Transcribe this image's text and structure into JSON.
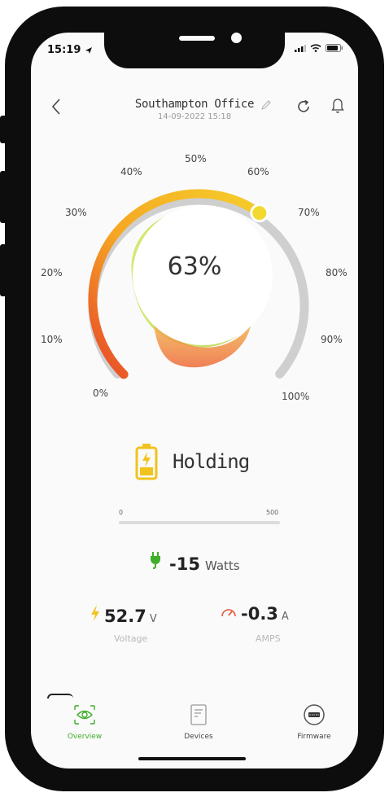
{
  "status_bar": {
    "time": "15:19"
  },
  "header": {
    "location": "Southampton Office",
    "timestamp": "14-09-2022  15:18",
    "icons": [
      "back-arrow-icon",
      "edit-pencil-icon",
      "refresh-icon",
      "bell-icon"
    ]
  },
  "gauge": {
    "value_percent": 63,
    "display": "63%",
    "ticks": [
      "0%",
      "10%",
      "20%",
      "30%",
      "40%",
      "50%",
      "60%",
      "70%",
      "80%",
      "90%",
      "100%"
    ],
    "colors": {
      "low": "#e8462a",
      "mid": "#f5a623",
      "high": "#f5cd2b",
      "track": "#cfcfcf",
      "knob": "#f2d92e"
    }
  },
  "battery": {
    "status": "Holding",
    "icon": "battery-charging-icon",
    "color": "#f2c21e"
  },
  "power_range": {
    "min": "0",
    "max": "500"
  },
  "power": {
    "value": "-15",
    "unit": "Watts",
    "icon": "plug-icon"
  },
  "voltage": {
    "value": "52.7",
    "unit": "V",
    "label": "Voltage",
    "icon": "lightning-icon"
  },
  "current": {
    "value": "-0.3",
    "unit": "A",
    "label": "AMPS",
    "icon": "gauge-meter-icon"
  },
  "tabs": [
    {
      "label": "Overview",
      "icon": "eye-icon",
      "active": true
    },
    {
      "label": "Devices",
      "icon": "device-icon",
      "active": false
    },
    {
      "label": "Firmware",
      "icon": "firmware-icon",
      "active": false
    }
  ]
}
